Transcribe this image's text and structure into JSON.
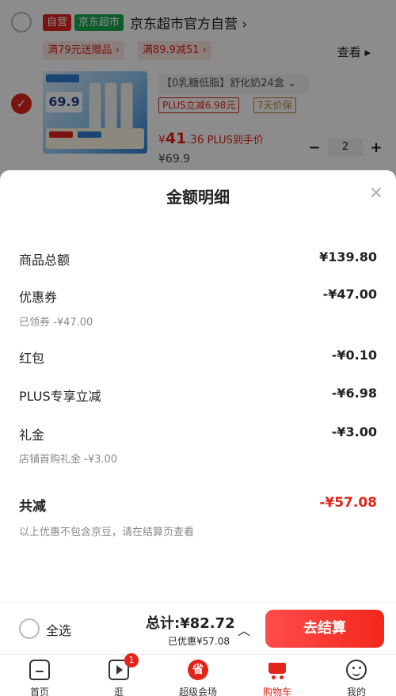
{
  "cart": {
    "store": {
      "badge_self": "自营",
      "badge_brand": "京东超市",
      "name": "京东超市官方自营 ›"
    },
    "promos": [
      "满79元送赠品 ›",
      "满89.9减51 ›"
    ],
    "see_more": "查看 ▸",
    "item": {
      "thumb_price": "69.9",
      "title": "【0乳糖低脂】舒化奶24盒 ⌄",
      "tags": [
        "PLUS立减6.98元",
        "7天价保"
      ],
      "price_prefix": "¥",
      "price_int": "41",
      "price_dec": ".36",
      "price_note": "PLUS到手价",
      "orig_price": "¥69.9",
      "qty": "2",
      "minus": "−",
      "plus": "+"
    }
  },
  "sheet": {
    "title": "金额明细",
    "close": "×",
    "rows": [
      {
        "label": "商品总额",
        "value": "¥139.80"
      },
      {
        "label": "优惠券",
        "value": "-¥47.00",
        "sub": "已领券 -¥47.00"
      },
      {
        "label": "红包",
        "value": "-¥0.10"
      },
      {
        "label": "PLUS专享立减",
        "value": "-¥6.98"
      },
      {
        "label": "礼金",
        "value": "-¥3.00",
        "sub": "店铺首购礼金 -¥3.00"
      }
    ],
    "total": {
      "label": "共减",
      "value": "-¥57.08"
    },
    "note": "以上优惠不包含京豆，请在结算页查看"
  },
  "checkout": {
    "select_all": "全选",
    "total": "总计:¥82.72",
    "discount": "已优惠¥57.08",
    "chevron": "︿",
    "button": "去结算"
  },
  "tabs": {
    "home": "首页",
    "stroll": "逛",
    "stroll_badge": "1",
    "super": "超级会场",
    "super_icon_text": "省",
    "cart": "购物车",
    "me": "我的"
  },
  "colors": {
    "accent": "#e1251b",
    "brand_green": "#18a94f"
  }
}
